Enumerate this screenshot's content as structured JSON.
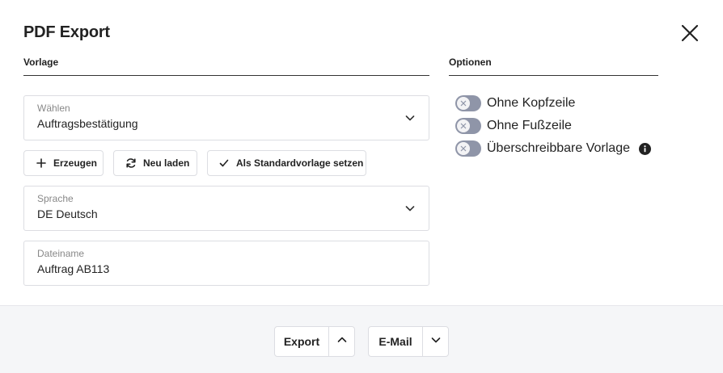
{
  "dialog": {
    "title": "PDF Export"
  },
  "sections": {
    "vorlage": "Vorlage",
    "optionen": "Optionen"
  },
  "template_select": {
    "label": "Wählen",
    "value": "Auftragsbestätigung"
  },
  "actions": {
    "erzeugen": "Erzeugen",
    "neu_laden": "Neu laden",
    "standard": "Als Standardvorlage setzen"
  },
  "language_select": {
    "label": "Sprache",
    "value": "DE Deutsch"
  },
  "filename": {
    "label": "Dateiname",
    "value": "Auftrag AB113"
  },
  "options": [
    {
      "label": "Ohne Kopfzeile",
      "enabled": false
    },
    {
      "label": "Ohne Fußzeile",
      "enabled": false
    },
    {
      "label": "Überschreibbare Vorlage",
      "enabled": false
    }
  ],
  "footer": {
    "export_label": "Export",
    "email_label": "E-Mail"
  },
  "colors": {
    "toggle_off": "#8f95a8",
    "border": "#dcdde2",
    "footer_bg": "#f5f6f8"
  }
}
